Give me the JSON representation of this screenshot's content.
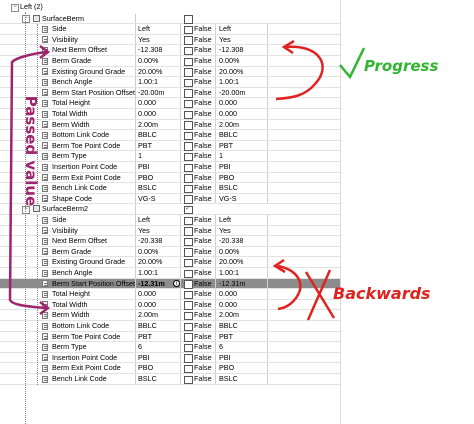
{
  "tree_root_label": "Left (2)",
  "groups": [
    {
      "label": "SurfaceBerm",
      "checked": false,
      "rows": [
        {
          "name": "Side",
          "value": "Left",
          "flag": "False",
          "value2": "Left"
        },
        {
          "name": "Visibility",
          "value": "Yes",
          "flag": "False",
          "value2": "Yes"
        },
        {
          "name": "Next Berm Offset",
          "value": "-12.308",
          "flag": "False",
          "value2": "-12.308"
        },
        {
          "name": "Berm Grade",
          "value": "0.00%",
          "flag": "False",
          "value2": "0.00%"
        },
        {
          "name": "Existing Ground Grade",
          "value": "20.00%",
          "flag": "False",
          "value2": "20.00%"
        },
        {
          "name": "Bench Angle",
          "value": "1.00:1",
          "flag": "False",
          "value2": "1.00:1"
        },
        {
          "name": "Berm Start Position Offset",
          "value": "-20.00m",
          "flag": "False",
          "value2": "-20.00m"
        },
        {
          "name": "Total Height",
          "value": "0.000",
          "flag": "False",
          "value2": "0.000"
        },
        {
          "name": "Total Width",
          "value": "0.000",
          "flag": "False",
          "value2": "0.000"
        },
        {
          "name": "Berm Width",
          "value": "2.00m",
          "flag": "False",
          "value2": "2.00m"
        },
        {
          "name": "Bottom Link Code",
          "value": "BBLC",
          "flag": "False",
          "value2": "BBLC"
        },
        {
          "name": "Berm Toe Point Code",
          "value": "PBT",
          "flag": "False",
          "value2": "PBT"
        },
        {
          "name": "Berm Type",
          "value": "1",
          "flag": "False",
          "value2": "1"
        },
        {
          "name": "Insertion Point Code",
          "value": "PBI",
          "flag": "False",
          "value2": "PBI"
        },
        {
          "name": "Berm Exit Point Code",
          "value": "PBO",
          "flag": "False",
          "value2": "PBO"
        },
        {
          "name": "Bench Link Code",
          "value": "BSLC",
          "flag": "False",
          "value2": "BSLC"
        },
        {
          "name": "Shape Code",
          "value": "VG-S",
          "flag": "False",
          "value2": "VG-S"
        }
      ]
    },
    {
      "label": "SurfaceBerm2",
      "checked": true,
      "rows": [
        {
          "name": "Side",
          "value": "Left",
          "flag": "False",
          "value2": "Left"
        },
        {
          "name": "Visibility",
          "value": "Yes",
          "flag": "False",
          "value2": "Yes"
        },
        {
          "name": "Next Berm Offset",
          "value": "-20.338",
          "flag": "False",
          "value2": "-20.338"
        },
        {
          "name": "Berm Grade",
          "value": "0.00%",
          "flag": "False",
          "value2": "0.00%"
        },
        {
          "name": "Existing Ground Grade",
          "value": "20.00%",
          "flag": "False",
          "value2": "20.00%"
        },
        {
          "name": "Bench Angle",
          "value": "1.00:1",
          "flag": "False",
          "value2": "1.00:1"
        },
        {
          "name": "Berm Start Position Offset",
          "value": "-12.31m",
          "flag": "False",
          "value2": "-12.31m",
          "selected": true
        },
        {
          "name": "Total Height",
          "value": "0.000",
          "flag": "False",
          "value2": "0.000"
        },
        {
          "name": "Total Width",
          "value": "0.000",
          "flag": "False",
          "value2": "0.000"
        },
        {
          "name": "Berm Width",
          "value": "2.00m",
          "flag": "False",
          "value2": "2.00m"
        },
        {
          "name": "Bottom Link Code",
          "value": "BBLC",
          "flag": "False",
          "value2": "BBLC"
        },
        {
          "name": "Berm Toe Point Code",
          "value": "PBT",
          "flag": "False",
          "value2": "PBT"
        },
        {
          "name": "Berm Type",
          "value": "6",
          "flag": "False",
          "value2": "6"
        },
        {
          "name": "Insertion Point Code",
          "value": "PBI",
          "flag": "False",
          "value2": "PBI"
        },
        {
          "name": "Berm Exit Point Code",
          "value": "PBO",
          "flag": "False",
          "value2": "PBO"
        },
        {
          "name": "Bench Link Code",
          "value": "BSLC",
          "flag": "False",
          "value2": "BSLC"
        }
      ]
    }
  ],
  "annotations": {
    "progress_label": "Progress",
    "backwards_label": "Backwards",
    "passed_value_label": "Passed value",
    "colors": {
      "progress_check": "#2fb52f",
      "red_ink": "#e0231f",
      "purple_ink": "#a0236e"
    }
  }
}
